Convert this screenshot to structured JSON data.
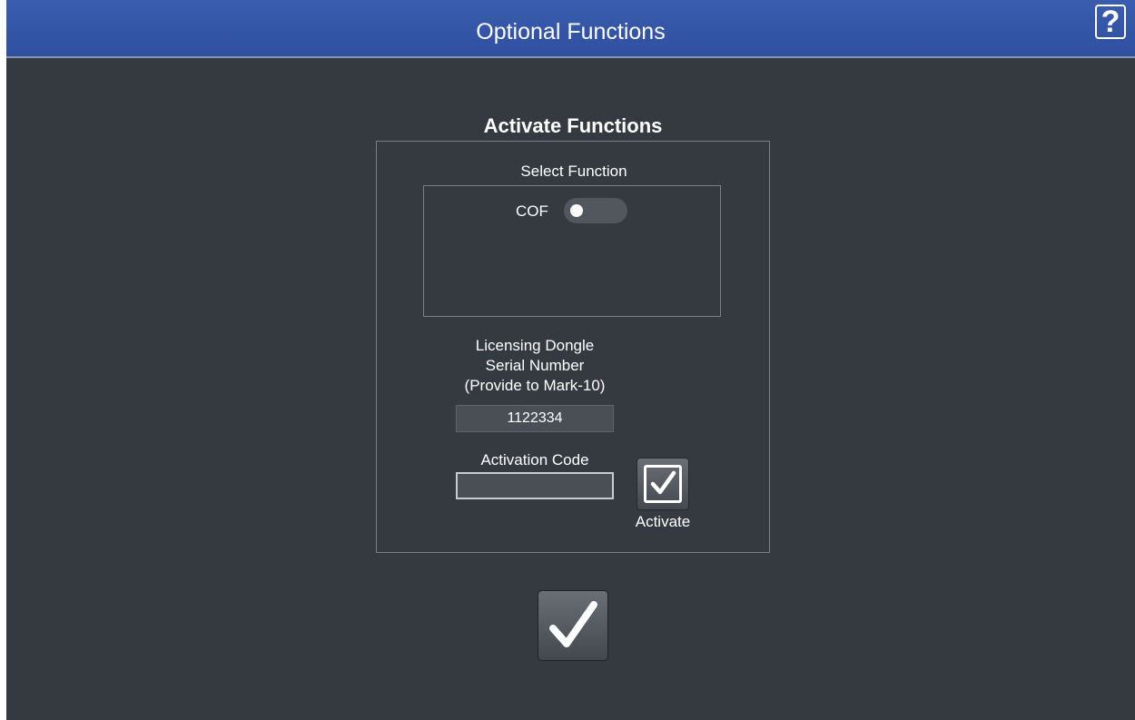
{
  "window": {
    "title": "Optional Functions",
    "help_label": "?"
  },
  "activate_section": {
    "title": "Activate Functions",
    "select_function_label": "Select Function",
    "functions": [
      {
        "label": "COF",
        "enabled": false
      }
    ],
    "dongle": {
      "label_line1": "Licensing Dongle",
      "label_line2": "Serial Number",
      "label_line3": "(Provide to Mark-10)",
      "serial_value": "1122334"
    },
    "activation_code": {
      "label": "Activation Code",
      "value": "",
      "button_label": "Activate"
    }
  },
  "icons": {
    "help": "question-mark-icon",
    "activate": "checkbox-check-icon",
    "ok": "checkmark-icon"
  },
  "colors": {
    "titlebar": "#2f4f9e",
    "background": "#353940",
    "text": "#ffffff"
  }
}
